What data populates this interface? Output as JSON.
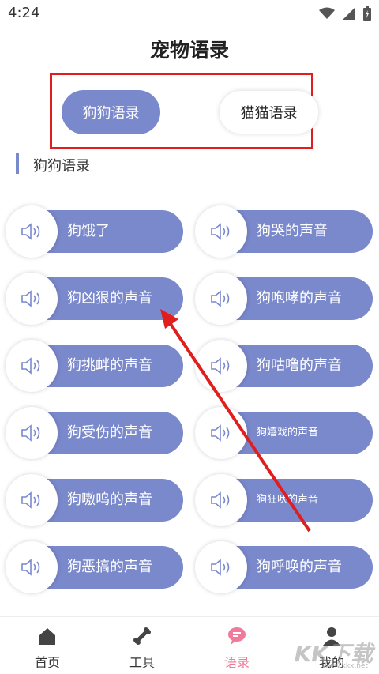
{
  "status_bar": {
    "time": "4:24",
    "icons": [
      "wifi-icon",
      "signal-icon",
      "battery-icon"
    ]
  },
  "header": {
    "title": "宠物语录"
  },
  "tabs": [
    {
      "label": "狗狗语录",
      "active": true
    },
    {
      "label": "猫猫语录",
      "active": false
    }
  ],
  "section": {
    "label": "狗狗语录"
  },
  "sounds": [
    {
      "label": "狗饿了"
    },
    {
      "label": "狗哭的声音"
    },
    {
      "label": "狗凶狠的声音"
    },
    {
      "label": "狗咆哮的声音"
    },
    {
      "label": "狗挑衅的声音"
    },
    {
      "label": "狗咕噜的声音"
    },
    {
      "label": "狗受伤的声音"
    },
    {
      "label": "狗嬉戏的声音"
    },
    {
      "label": "狗嗷呜的声音"
    },
    {
      "label": "狗狂吠的声音"
    },
    {
      "label": "狗恶搞的声音"
    },
    {
      "label": "狗呼唤的声音"
    }
  ],
  "bottom_nav": [
    {
      "label": "首页",
      "icon": "home-icon",
      "active": false
    },
    {
      "label": "工具",
      "icon": "bone-icon",
      "active": false
    },
    {
      "label": "语录",
      "icon": "chat-icon",
      "active": true
    },
    {
      "label": "我的",
      "icon": "user-icon",
      "active": false
    }
  ],
  "watermark": {
    "text": "KK下载",
    "sub": "www.kkx.net"
  },
  "colors": {
    "accent": "#7a88cc",
    "highlight_frame": "#e01e1e",
    "active_nav": "#f07a9a"
  }
}
